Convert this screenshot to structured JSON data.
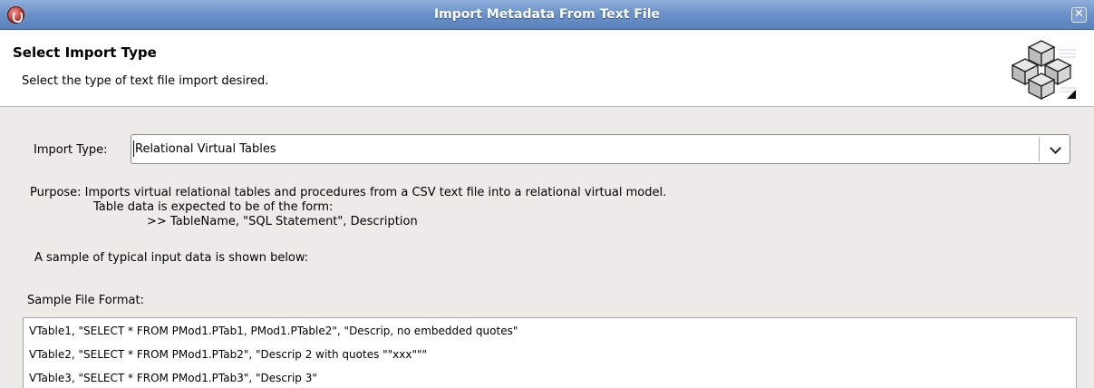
{
  "window": {
    "title": "Import Metadata From Text File",
    "close_glyph": "✕"
  },
  "header": {
    "title": "Select Import Type",
    "subtitle": "Select the type of text file import desired."
  },
  "form": {
    "import_type_label": "Import Type:",
    "import_type_value": "Relational Virtual Tables"
  },
  "purpose": {
    "line1": "Purpose:  Imports virtual relational tables and procedures from a CSV text file into a relational virtual model.",
    "line2": "Table data is expected to be of the form:",
    "line3": ">> TableName, \"SQL Statement\", Description"
  },
  "sample": {
    "intro": "A sample of typical input data is shown below:",
    "label": "Sample File Format:",
    "rows": [
      "VTable1, \"SELECT * FROM PMod1.PTab1, PMod1.PTable2\", \"Descrip, no embedded quotes\"",
      "VTable2, \"SELECT * FROM PMod1.PTab2\", \"Descrip 2 with quotes \"\"xxx\"\"\"",
      "VTable3, \"SELECT * FROM PMod1.PTab3\", \"Descrip 3\""
    ]
  },
  "icons": {
    "app": "app-logo-icon",
    "close": "close-icon",
    "dropdown": "chevron-down-icon",
    "header": "cubes-import-icon"
  }
}
